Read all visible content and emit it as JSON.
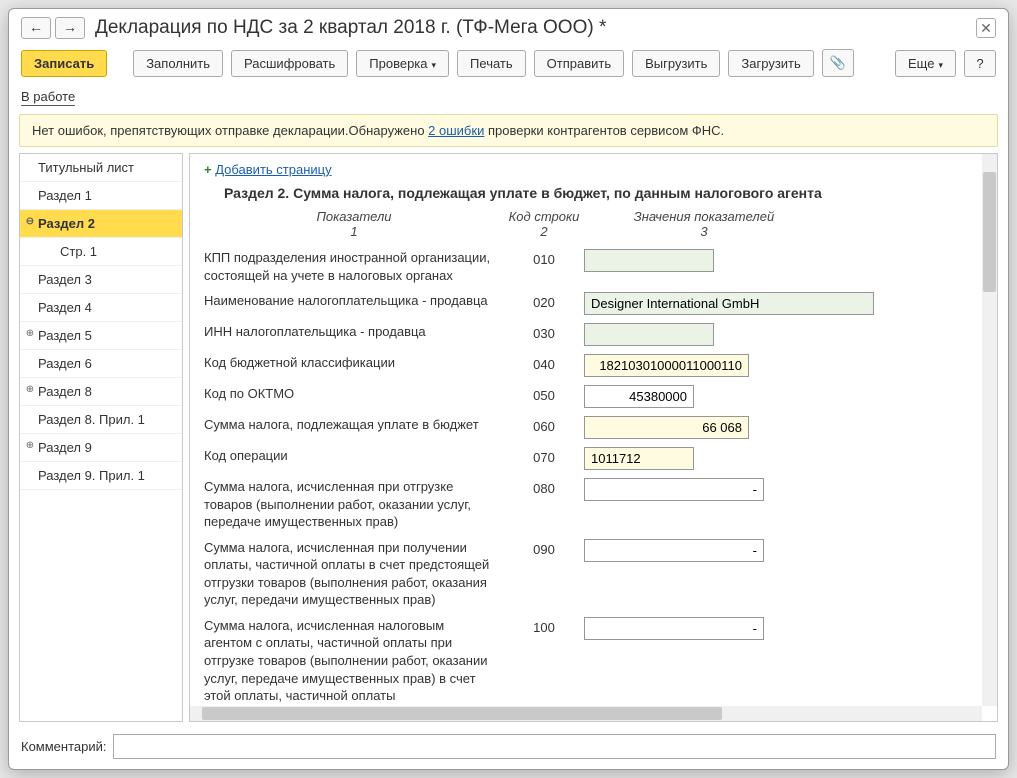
{
  "window_title": "Декларация по НДС за 2 квартал 2018 г. (ТФ-Мега ООО) *",
  "toolbar": {
    "write": "Записать",
    "fill": "Заполнить",
    "decrypt": "Расшифровать",
    "check": "Проверка",
    "print": "Печать",
    "send": "Отправить",
    "export": "Выгрузить",
    "import": "Загрузить",
    "more": "Еще"
  },
  "status_label": "В работе",
  "info": {
    "pre": "Нет ошибок, препятствующих отправке декларации.Обнаружено ",
    "link": "2 ошибки",
    "post": " проверки контрагентов сервисом ФНС."
  },
  "sidebar": [
    {
      "label": "Титульный лист",
      "child": false,
      "exp": ""
    },
    {
      "label": "Раздел 1",
      "child": false,
      "exp": ""
    },
    {
      "label": "Раздел 2",
      "child": false,
      "exp": "⊖",
      "selected": true
    },
    {
      "label": "Стр. 1",
      "child": true,
      "exp": ""
    },
    {
      "label": "Раздел 3",
      "child": false,
      "exp": ""
    },
    {
      "label": "Раздел 4",
      "child": false,
      "exp": ""
    },
    {
      "label": "Раздел 5",
      "child": false,
      "exp": "⊕"
    },
    {
      "label": "Раздел 6",
      "child": false,
      "exp": ""
    },
    {
      "label": "Раздел 8",
      "child": false,
      "exp": "⊕"
    },
    {
      "label": "Раздел 8. Прил. 1",
      "child": false,
      "exp": ""
    },
    {
      "label": "Раздел 9",
      "child": false,
      "exp": "⊕"
    },
    {
      "label": "Раздел 9. Прил. 1",
      "child": false,
      "exp": ""
    }
  ],
  "add_page": "Добавить страницу",
  "section_title": "Раздел 2. Сумма налога, подлежащая уплате в бюджет, по данным налогового агента",
  "headers": {
    "col1_a": "Показатели",
    "col1_b": "1",
    "col2_a": "Код строки",
    "col2_b": "2",
    "col3_a": "Значения показателей",
    "col3_b": "3"
  },
  "rows": [
    {
      "label": "КПП подразделения иностранной организации, состоящей на учете в налоговых органах",
      "code": "010",
      "value": "",
      "w": "w130",
      "style": "readonly"
    },
    {
      "label": "Наименование налогоплательщика - продавца",
      "code": "020",
      "value": "Designer International GmbH",
      "w": "w290",
      "style": "readonly"
    },
    {
      "label": "ИНН налогоплательщика - продавца",
      "code": "030",
      "value": "",
      "w": "w130",
      "style": "readonly"
    },
    {
      "label": "Код бюджетной классификации",
      "code": "040",
      "value": "18210301000011000110",
      "w": "w165",
      "style": "yellow"
    },
    {
      "label": "Код по ОКТМО",
      "code": "050",
      "value": "45380000",
      "w": "w110",
      "style": "plain"
    },
    {
      "label": "Сумма налога, подлежащая уплате в бюджет",
      "code": "060",
      "value": "66 068",
      "w": "w165",
      "style": "yellow"
    },
    {
      "label": "Код операции",
      "code": "070",
      "value": "1011712",
      "w": "w110",
      "style": "yellow",
      "align": "left"
    },
    {
      "label": "Сумма налога, исчисленная при отгрузке товаров (выполнении работ, оказании услуг, передаче имущественных прав)",
      "code": "080",
      "value": "-",
      "w": "w180",
      "style": "plain"
    },
    {
      "label": "Сумма налога, исчисленная при получении оплаты, частичной оплаты в счет предстоящей отгрузки товаров (выполнения работ, оказания услуг, передачи имущественных прав)",
      "code": "090",
      "value": "-",
      "w": "w180",
      "style": "plain"
    },
    {
      "label": "Сумма налога, исчисленная налоговым агентом с оплаты, частичной оплаты при отгрузке товаров (выполнении работ, оказании услуг, передаче имущественных прав) в счет этой оплаты, частичной оплаты",
      "code": "100",
      "value": "-",
      "w": "w180",
      "style": "plain"
    }
  ],
  "comment_label": "Комментарий:",
  "comment_value": ""
}
